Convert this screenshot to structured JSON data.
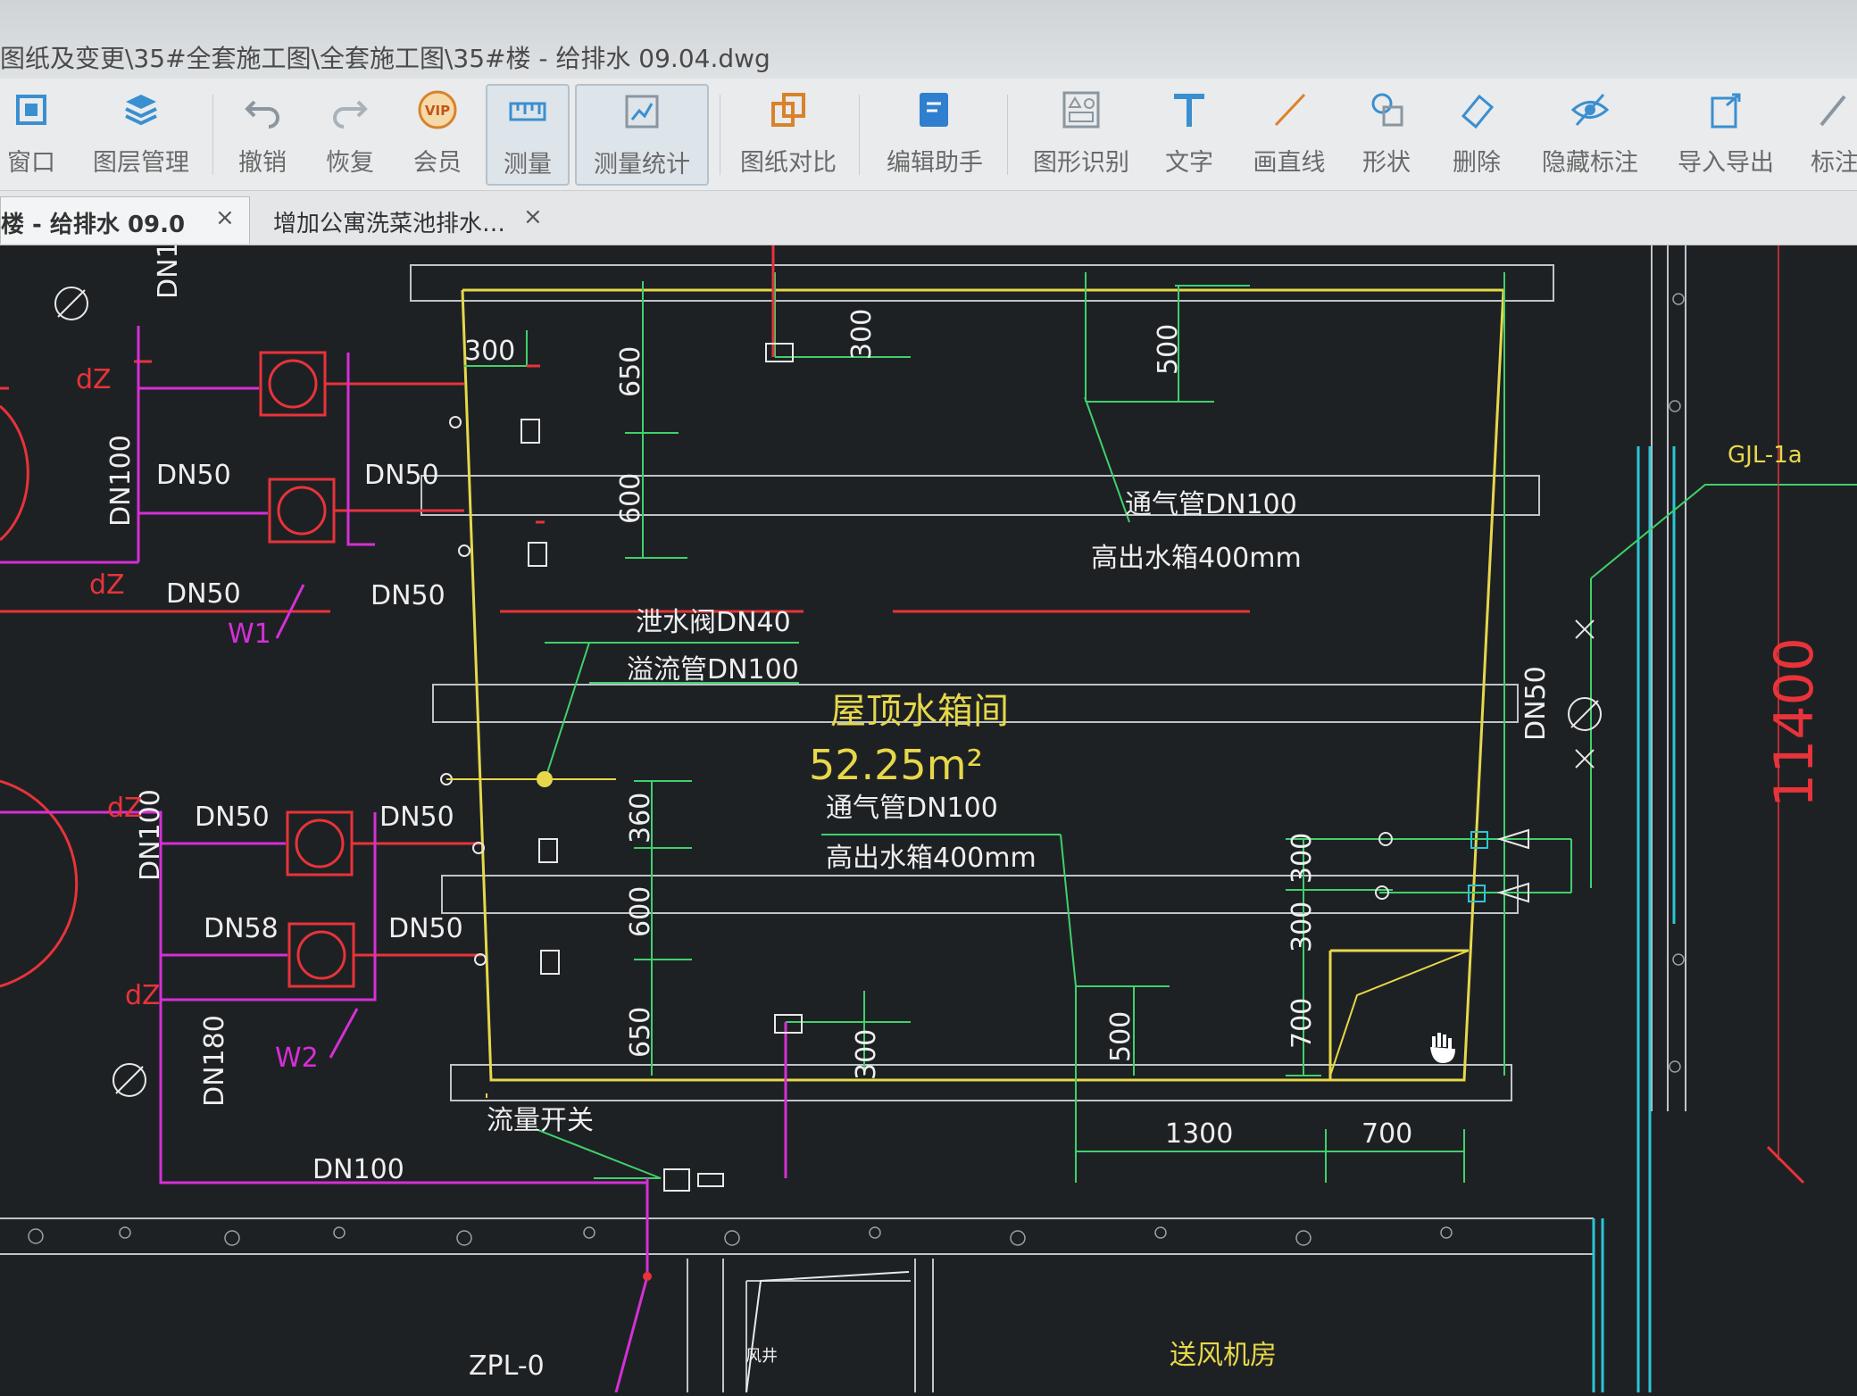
{
  "window": {
    "title": "图纸及变更\\35#全套施工图\\全套施工图\\35#楼 - 给排水 09.04.dwg"
  },
  "toolbar": {
    "items": [
      {
        "label": "窗口",
        "icon": "window-icon"
      },
      {
        "label": "图层管理",
        "icon": "layers-icon"
      },
      {
        "label": "撤销",
        "icon": "undo-icon"
      },
      {
        "label": "恢复",
        "icon": "redo-icon"
      },
      {
        "label": "会员",
        "icon": "vip-icon"
      },
      {
        "label": "测量",
        "icon": "ruler-icon"
      },
      {
        "label": "测量统计",
        "icon": "measure-stats-icon"
      },
      {
        "label": "图纸对比",
        "icon": "compare-icon"
      },
      {
        "label": "编辑助手",
        "icon": "edit-assistant-icon"
      },
      {
        "label": "图形识别",
        "icon": "shape-recognition-icon"
      },
      {
        "label": "文字",
        "icon": "text-icon"
      },
      {
        "label": "画直线",
        "icon": "line-icon"
      },
      {
        "label": "形状",
        "icon": "shape-icon"
      },
      {
        "label": "删除",
        "icon": "eraser-icon"
      },
      {
        "label": "隐藏标注",
        "icon": "hide-annotation-icon"
      },
      {
        "label": "导入导出",
        "icon": "import-export-icon"
      },
      {
        "label": "标注",
        "icon": "annotation-icon"
      }
    ],
    "vip_badge": "VIP"
  },
  "tabs": [
    {
      "label": "楼 - 给排水 09.0",
      "close": "×"
    },
    {
      "label": "增加公寓洗菜池排水…",
      "close": "×"
    }
  ],
  "drawing": {
    "room_name": "屋顶水箱间",
    "room_area": "52.25m²",
    "pipes": {
      "dn50_a": "DN50",
      "dn50_b": "DN50",
      "dn50_c": "DN50",
      "dn50_d": "DN50",
      "dn50_e": "DN50",
      "dn50_f": "DN50",
      "dn58_g": "DN58",
      "dn50_h": "DN50",
      "dn100_left_a": "DN100",
      "dn100_left_b": "DN100",
      "dn180": "DN180",
      "dn100_bottom": "DN100",
      "dn_top_cut": "DN1",
      "dn_right": "DN50"
    },
    "notes": {
      "vent_top": "通气管DN100",
      "vent_top_height": "高出水箱400mm",
      "drain_valve": "泄水阀DN40",
      "overflow": "溢流管DN100",
      "vent_mid": "通气管DN100",
      "vent_mid_height": "高出水箱400mm",
      "flow_switch": "流量开关"
    },
    "labels": {
      "w1": "W1",
      "w2": "W2",
      "dz_a": "dZ",
      "dz_b": "dZ",
      "dz_c": "dZ",
      "dz_d": "dZ",
      "gjl": "GJL-1a",
      "zpl": "ZPL-0",
      "fan_room": "送风机房",
      "shaft": "风井"
    },
    "dimensions": {
      "d300_a": "300",
      "d650_a": "650",
      "d600_a": "600",
      "d300_b": "300",
      "d500_a": "500",
      "d360": "360",
      "d600_b": "600",
      "d650_b": "650",
      "d300_c": "300",
      "d500_b": "500",
      "d300_d": "300",
      "d300_e": "300",
      "d700_v": "700",
      "d1300": "1300",
      "d700_h": "700",
      "d11400": "11400"
    }
  }
}
